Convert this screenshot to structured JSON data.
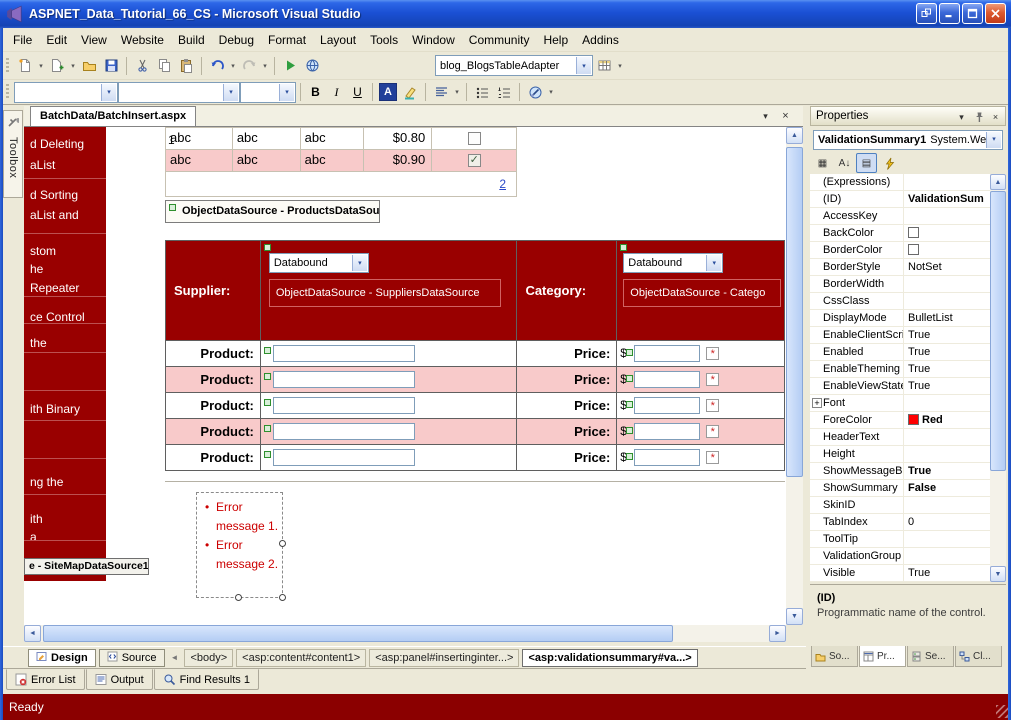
{
  "window": {
    "title": "ASPNET_Data_Tutorial_66_CS - Microsoft Visual Studio",
    "status_text": "Ready"
  },
  "menu": {
    "items": [
      "File",
      "Edit",
      "View",
      "Website",
      "Build",
      "Debug",
      "Format",
      "Layout",
      "Tools",
      "Window",
      "Community",
      "Help",
      "Addins"
    ]
  },
  "toolbars": {
    "standard": {
      "adapter_combo": "blog_BlogsTableAdapter"
    },
    "formatting": {
      "bold": "B",
      "italic": "I",
      "underline": "U",
      "forecolor_letter": "A"
    }
  },
  "toolbox": {
    "label": "Toolbox"
  },
  "editor": {
    "tab_title": "BatchData/BatchInsert.aspx",
    "sidebar": {
      "fragments": [
        "d Deleting",
        "aList",
        "d Sorting",
        "aList and",
        "stom",
        "he",
        "Repeater",
        "ce Control",
        "the",
        "ith Binary",
        "ng the",
        "ith",
        "a"
      ],
      "datasource_label": "e - SiteMapDataSource1"
    },
    "gridview": {
      "rows": [
        {
          "cells": [
            "abc",
            "abc",
            "abc",
            "$0.80"
          ],
          "checked": false
        },
        {
          "cells": [
            "abc",
            "abc",
            "abc",
            "$0.90"
          ],
          "checked": true
        }
      ],
      "pager_current": "1",
      "pager_link": "2"
    },
    "products_datasource": "ObjectDataSource - ProductsDataSource",
    "insert_table": {
      "supplier_label": "Supplier:",
      "category_label": "Category:",
      "supplier_dropdown_value": "Databound",
      "category_dropdown_value": "Databound",
      "suppliers_datasource": "ObjectDataSource - SuppliersDataSource",
      "categories_datasource": "ObjectDataSource - Catego",
      "product_label": "Product:",
      "price_label": "Price:",
      "currency_symbol": "$",
      "row_count": 5
    },
    "validation_summary": {
      "items": [
        {
          "lines": [
            "Error",
            "message 1."
          ]
        },
        {
          "lines": [
            "Error",
            "message 2."
          ]
        }
      ]
    }
  },
  "properties_panel": {
    "title": "Properties",
    "object_name": "ValidationSummary1",
    "object_type": "System.We",
    "rows": [
      {
        "name": "(Expressions)",
        "value": ""
      },
      {
        "name": "(ID)",
        "value": "ValidationSum",
        "bold": true
      },
      {
        "name": "AccessKey",
        "value": ""
      },
      {
        "name": "BackColor",
        "value": "",
        "swatch": "#FFFFFF"
      },
      {
        "name": "BorderColor",
        "value": "",
        "swatch": "#FFFFFF"
      },
      {
        "name": "BorderStyle",
        "value": "NotSet"
      },
      {
        "name": "BorderWidth",
        "value": ""
      },
      {
        "name": "CssClass",
        "value": ""
      },
      {
        "name": "DisplayMode",
        "value": "BulletList"
      },
      {
        "name": "EnableClientScri",
        "value": "True"
      },
      {
        "name": "Enabled",
        "value": "True"
      },
      {
        "name": "EnableTheming",
        "value": "True"
      },
      {
        "name": "EnableViewState",
        "value": "True"
      },
      {
        "name": "Font",
        "value": "",
        "expandable": true
      },
      {
        "name": "ForeColor",
        "value": "Red",
        "swatch": "#FF0000",
        "bold": true
      },
      {
        "name": "HeaderText",
        "value": ""
      },
      {
        "name": "Height",
        "value": ""
      },
      {
        "name": "ShowMessageBo",
        "value": "True",
        "bold": true
      },
      {
        "name": "ShowSummary",
        "value": "False",
        "bold": true
      },
      {
        "name": "SkinID",
        "value": ""
      },
      {
        "name": "TabIndex",
        "value": "0"
      },
      {
        "name": "ToolTip",
        "value": ""
      },
      {
        "name": "ValidationGroup",
        "value": ""
      },
      {
        "name": "Visible",
        "value": "True"
      }
    ],
    "help_title": "(ID)",
    "help_text": "Programmatic name of the control.",
    "tabs": [
      {
        "label": "So..."
      },
      {
        "label": "Pr...",
        "active": true
      },
      {
        "label": "Se..."
      },
      {
        "label": "Cl..."
      }
    ]
  },
  "tag_navigator": {
    "design_label": "Design",
    "source_label": "Source",
    "tags": [
      {
        "label": "<body>"
      },
      {
        "label": "<asp:content#content1>"
      },
      {
        "label": "<asp:panel#insertinginter...>"
      },
      {
        "label": "<asp:validationsummary#va...>",
        "active": true
      }
    ]
  },
  "bottom_tabs": [
    {
      "label": "Error List"
    },
    {
      "label": "Output"
    },
    {
      "label": "Find Results 1"
    }
  ],
  "icons": {
    "dropdown_arrow": "▾",
    "close": "×",
    "scroll_up": "▲",
    "scroll_down": "▼",
    "scroll_left": "◄",
    "scroll_right": "►",
    "checkmark": "✓",
    "expander": "+",
    "validator_glyph": "*",
    "sort_alpha": "A↓",
    "categorized": "▦",
    "property_pages": "▤",
    "tag_scroll": "◄",
    "bullet": "•"
  },
  "colors": {
    "accent_red": "#990000",
    "row_pink": "#f8caca",
    "status_red": "#8b0000",
    "error_text": "#cc0000"
  }
}
